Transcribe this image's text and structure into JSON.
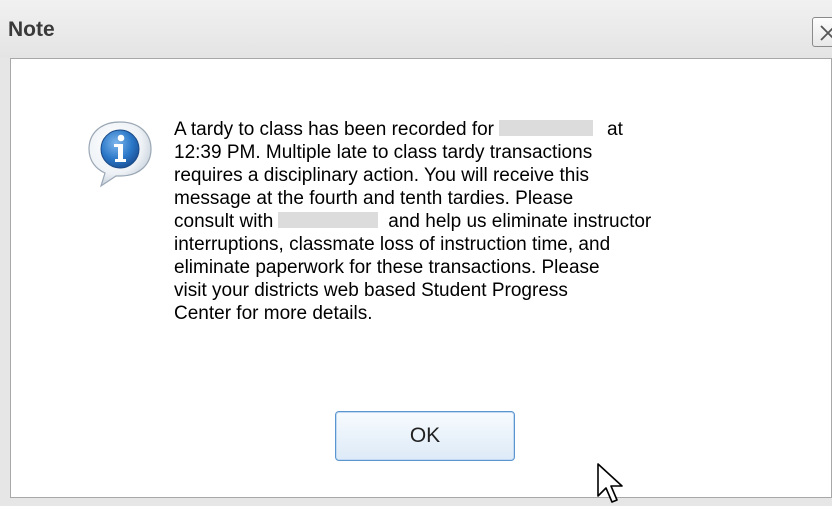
{
  "dialog": {
    "title": "Note",
    "close_icon": "close-icon",
    "info_icon": "info-speech-bubble-icon",
    "message_lines": [
      [
        "A tardy to class has been recorded for",
        "at"
      ],
      [
        "12:39 PM. Multiple late to class tardy transactions"
      ],
      [
        "requires a disciplinary action. You will receive this"
      ],
      [
        "message at the fourth and tenth tardies. Please"
      ],
      [
        "consult with",
        "and help us eliminate instructor"
      ],
      [
        "interruptions, classmate loss of instruction time, and"
      ],
      [
        "eliminate paperwork for these transactions. Please"
      ],
      [
        "visit your districts web based Student Progress"
      ],
      [
        "Center for more details."
      ]
    ],
    "ok_label": "OK",
    "cursor_icon": "mouse-pointer-icon"
  }
}
